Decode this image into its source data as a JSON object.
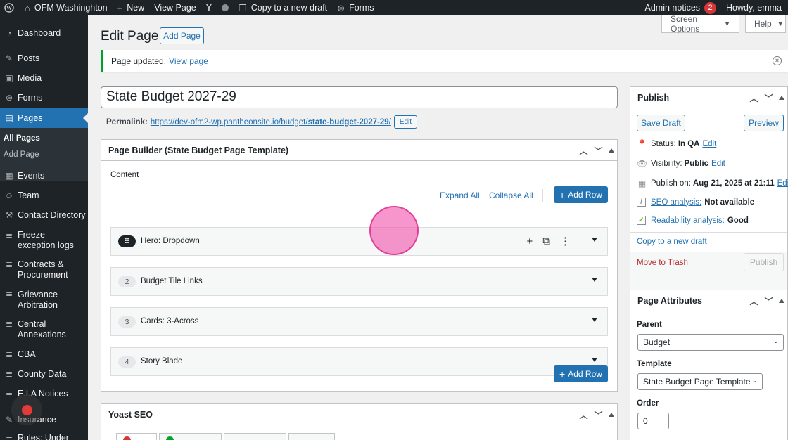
{
  "adminbar": {
    "site_name": "OFM Washinghton",
    "new_label": "New",
    "view_page": "View Page",
    "copy_draft": "Copy to a new draft",
    "forms": "Forms",
    "admin_notices": "Admin notices",
    "notice_count": "2",
    "howdy": "Howdy, emma"
  },
  "sidebar": {
    "items": [
      {
        "label": "Dashboard",
        "icon": "dashboard-icon"
      },
      {
        "label": "Posts",
        "icon": "pin-icon"
      },
      {
        "label": "Media",
        "icon": "media-icon"
      },
      {
        "label": "Forms",
        "icon": "forms-icon"
      },
      {
        "label": "Pages",
        "icon": "pages-icon"
      },
      {
        "label": "Events",
        "icon": "calendar-icon"
      },
      {
        "label": "Team",
        "icon": "team-icon"
      },
      {
        "label": "Contact Directory",
        "icon": "wrench-icon"
      },
      {
        "label": "Freeze exception logs",
        "icon": "database-icon"
      },
      {
        "label": "Contracts & Procurement",
        "icon": "database-icon"
      },
      {
        "label": "Grievance Arbitration",
        "icon": "database-icon"
      },
      {
        "label": "Central Annexations",
        "icon": "database-icon"
      },
      {
        "label": "CBA",
        "icon": "database-icon"
      },
      {
        "label": "County Data",
        "icon": "database-icon"
      },
      {
        "label": "E.I.A Notices",
        "icon": "database-icon"
      },
      {
        "label": "Insurance",
        "icon": "pin-icon"
      },
      {
        "label": "Rules: Under",
        "icon": "database-icon"
      }
    ],
    "submenu": {
      "all_pages": "All Pages",
      "add_page": "Add Page"
    }
  },
  "header": {
    "title": "Edit Page",
    "add_page": "Add Page",
    "screen_options": "Screen Options",
    "help": "Help"
  },
  "notice": {
    "text": "Page updated.",
    "link": "View page"
  },
  "post": {
    "title": "State Budget 2027-29",
    "permalink_label": "Permalink:",
    "permalink_base": "https://dev-ofm2-wp.pantheonsite.io/budget/",
    "permalink_slug": "state-budget-2027-29",
    "permalink_end": "/",
    "edit": "Edit"
  },
  "builder": {
    "title": "Page Builder (State Budget Page Template)",
    "content_label": "Content",
    "expand_all": "Expand All",
    "collapse_all": "Collapse All",
    "add_row": "Add Row",
    "rows": [
      {
        "num": "",
        "title": "Hero: Dropdown"
      },
      {
        "num": "2",
        "title": "Budget Tile Links"
      },
      {
        "num": "3",
        "title": "Cards: 3-Across"
      },
      {
        "num": "4",
        "title": "Story Blade"
      }
    ]
  },
  "yoast": {
    "title": "Yoast SEO"
  },
  "publish": {
    "title": "Publish",
    "save_draft": "Save Draft",
    "preview": "Preview",
    "status_label": "Status:",
    "status_value": "In QA",
    "visibility_label": "Visibility:",
    "visibility_value": "Public",
    "publish_on_label": "Publish on:",
    "publish_on_value": "Aug 21, 2025 at 21:11",
    "edit": "Edit",
    "seo_label": "SEO analysis:",
    "seo_value": "Not available",
    "readability_label": "Readability analysis:",
    "readability_value": "Good",
    "copy_draft": "Copy to a new draft",
    "trash": "Move to Trash",
    "publish_btn": "Publish"
  },
  "attributes": {
    "title": "Page Attributes",
    "parent_label": "Parent",
    "parent_value": "Budget",
    "template_label": "Template",
    "template_value": "State Budget Page Template",
    "order_label": "Order",
    "order_value": "0"
  },
  "colors": {
    "accent": "#2271b1",
    "sidebar": "#1d2327",
    "success": "#00a32a",
    "cursor_highlight": "#f050aa"
  }
}
